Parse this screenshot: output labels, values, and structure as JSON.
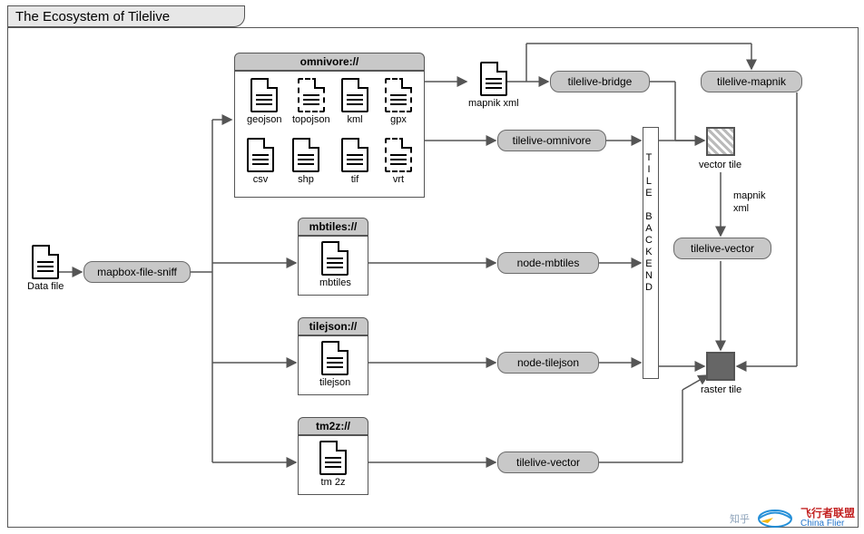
{
  "title": "The Ecosystem of Tilelive",
  "datafile_label": "Data file",
  "sniff": "mapbox-file-sniff",
  "omnivore": {
    "header": "omnivore://",
    "files": [
      {
        "name": "geojson",
        "dashed": false
      },
      {
        "name": "topojson",
        "dashed": true
      },
      {
        "name": "kml",
        "dashed": false
      },
      {
        "name": "gpx",
        "dashed": true
      },
      {
        "name": "csv",
        "dashed": false
      },
      {
        "name": "shp",
        "dashed": false
      },
      {
        "name": "tif",
        "dashed": false
      },
      {
        "name": "vrt",
        "dashed": true
      }
    ]
  },
  "tilelive_bridge": "tilelive-bridge",
  "tilelive_mapnik": "tilelive-mapnik",
  "tilelive_omnivore": "tilelive-omnivore",
  "mapnik_xml_label": "mapnik xml",
  "mapnik_xml_label2a": "mapnik",
  "mapnik_xml_label2b": "xml",
  "mbtiles": {
    "header": "mbtiles://",
    "file": "mbtiles"
  },
  "tilejson": {
    "header": "tilejson://",
    "file": "tilejson"
  },
  "tm2z": {
    "header": "tm2z://",
    "file": "tm 2z"
  },
  "node_mbtiles": "node-mbtiles",
  "node_tilejson": "node-tilejson",
  "tilelive_vector_top": "tilelive-vector",
  "tilelive_vector_bottom": "tilelive-vector",
  "tile_backend": "TILE BACKEND",
  "vector_tile_label": "vector tile",
  "raster_tile_label": "raster tile",
  "watermark_cn": "飞行者联盟",
  "watermark_en": "China Flier",
  "watermark_side": "知乎"
}
